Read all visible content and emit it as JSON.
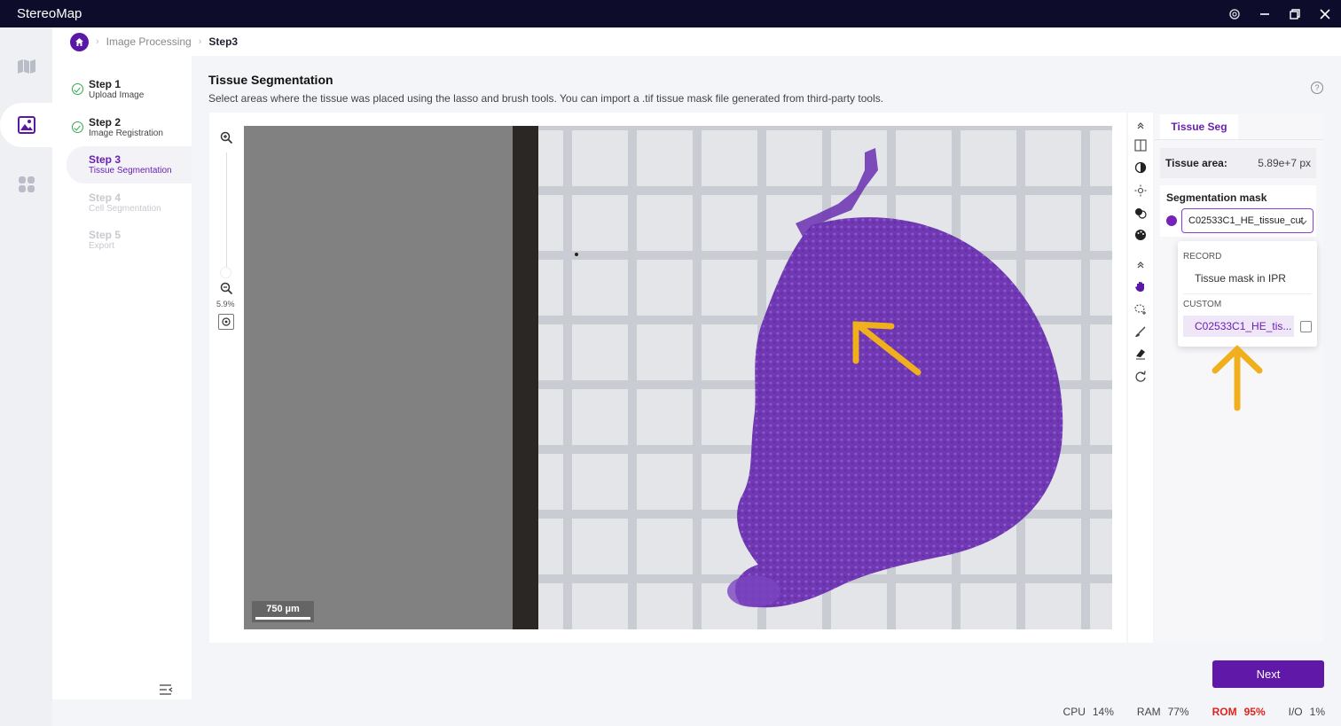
{
  "app": {
    "title": "StereoMap"
  },
  "breadcrumb": {
    "parent": "Image Processing",
    "current": "Step3"
  },
  "steps": [
    {
      "title": "Step 1",
      "subtitle": "Upload Image",
      "state": "done"
    },
    {
      "title": "Step 2",
      "subtitle": "Image Registration",
      "state": "done"
    },
    {
      "title": "Step 3",
      "subtitle": "Tissue Segmentation",
      "state": "active"
    },
    {
      "title": "Step 4",
      "subtitle": "Cell Segmentation",
      "state": "todo"
    },
    {
      "title": "Step 5",
      "subtitle": "Export",
      "state": "todo"
    }
  ],
  "main": {
    "title": "Tissue Segmentation",
    "description": "Select areas where the tissue was placed using the lasso and brush tools. You can import a .tif tissue mask file generated from third-party tools."
  },
  "viewer": {
    "zoom": "5.9%",
    "scale_label": "750 µm"
  },
  "panel": {
    "tab": "Tissue Seg",
    "area_label": "Tissue area:",
    "area_value": "5.89e+7 px",
    "mask_label": "Segmentation mask",
    "mask_selected": "C02533C1_HE_tissue_cut",
    "mask_color": "#7722b8",
    "dropdown": {
      "record_header": "RECORD",
      "record_item": "Tissue mask in IPR",
      "custom_header": "CUSTOM",
      "custom_item": "C02533C1_HE_tis..."
    }
  },
  "actions": {
    "next": "Next"
  },
  "status": {
    "cpu_label": "CPU",
    "cpu_value": "14%",
    "ram_label": "RAM",
    "ram_value": "77%",
    "rom_label": "ROM",
    "rom_value": "95%",
    "io_label": "I/O",
    "io_value": "1%"
  },
  "colors": {
    "accent": "#5f18a8",
    "tissue": "#6a2fb0",
    "warning": "#e0241c",
    "annotation_arrow": "#f0b01e"
  }
}
